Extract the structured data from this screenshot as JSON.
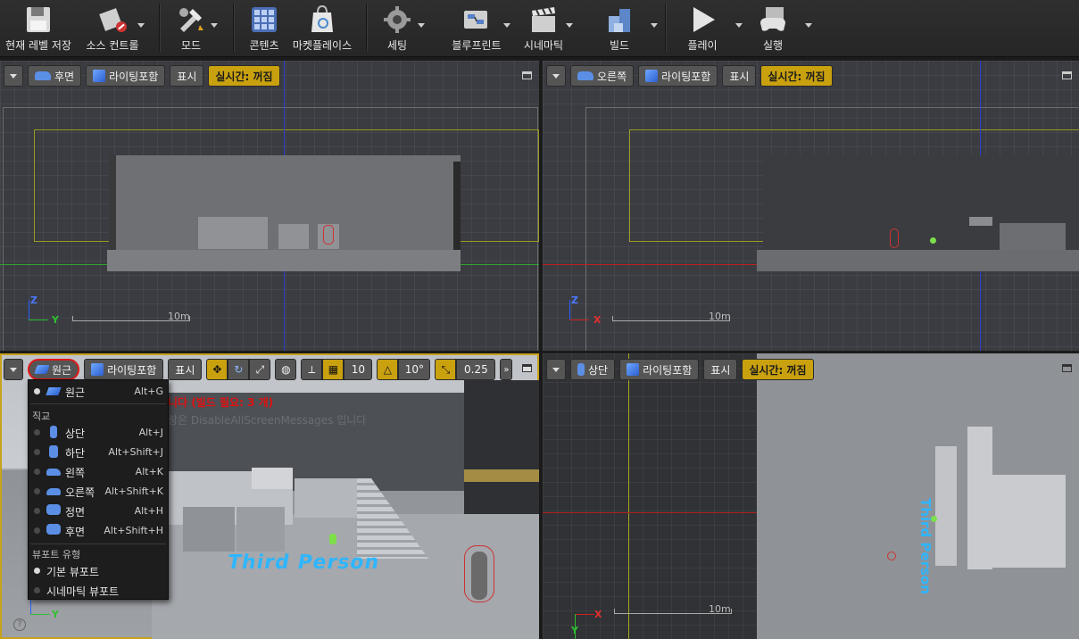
{
  "toolbar": {
    "save": "현재 레벨 저장",
    "source": "소스 컨트롤",
    "modes": "모드",
    "content": "콘텐츠",
    "marketplace": "마켓플레이스",
    "settings": "세팅",
    "blueprint": "블루프린트",
    "cinematics": "시네마틱",
    "build": "빌드",
    "play": "플레이",
    "launch": "실행"
  },
  "viewports": {
    "top_left": {
      "view": "후면",
      "lighting": "라이팅포함",
      "show": "표시",
      "realtime": "실시간: 꺼짐",
      "scale": "10m",
      "axes": [
        "Z",
        "Y"
      ]
    },
    "top_right": {
      "view": "오른쪽",
      "lighting": "라이팅포함",
      "show": "표시",
      "realtime": "실시간: 꺼짐",
      "scale": "10m",
      "axes": [
        "Z",
        "X"
      ]
    },
    "bottom_left": {
      "view": "원근",
      "lighting": "라이팅포함",
      "show": "표시",
      "grid_snap": "10",
      "rot_snap": "10°",
      "scale_snap": "0.25",
      "warning": "니다 (빌드 필요: 3 개)",
      "info": "랑은 DisableAllScreenMessages 입니다",
      "text3d": "Third Person",
      "axes": [
        "Z",
        "Y"
      ]
    },
    "bottom_right": {
      "view": "상단",
      "lighting": "라이팅포함",
      "show": "표시",
      "realtime": "실시간: 꺼짐",
      "scale": "10m",
      "text3d": "Third Person",
      "axes": [
        "X",
        "Y"
      ]
    }
  },
  "view_menu": {
    "perspective": {
      "label": "원근",
      "key": "Alt+G"
    },
    "ortho_header": "직교",
    "ortho": [
      {
        "label": "상단",
        "key": "Alt+J"
      },
      {
        "label": "하단",
        "key": "Alt+Shift+J"
      },
      {
        "label": "왼쪽",
        "key": "Alt+K"
      },
      {
        "label": "오른쪽",
        "key": "Alt+Shift+K"
      },
      {
        "label": "정면",
        "key": "Alt+H"
      },
      {
        "label": "후면",
        "key": "Alt+Shift+H"
      }
    ],
    "type_header": "뷰포트 유형",
    "types": [
      {
        "label": "기본 뷰포트"
      },
      {
        "label": "시네마틱 뷰포트"
      }
    ]
  },
  "colors": {
    "accent": "#c9a10f",
    "red_axis": "#d02020",
    "green_axis": "#2fbf2f",
    "blue_axis": "#2f5fff",
    "highlight_circle": "#e01818"
  }
}
